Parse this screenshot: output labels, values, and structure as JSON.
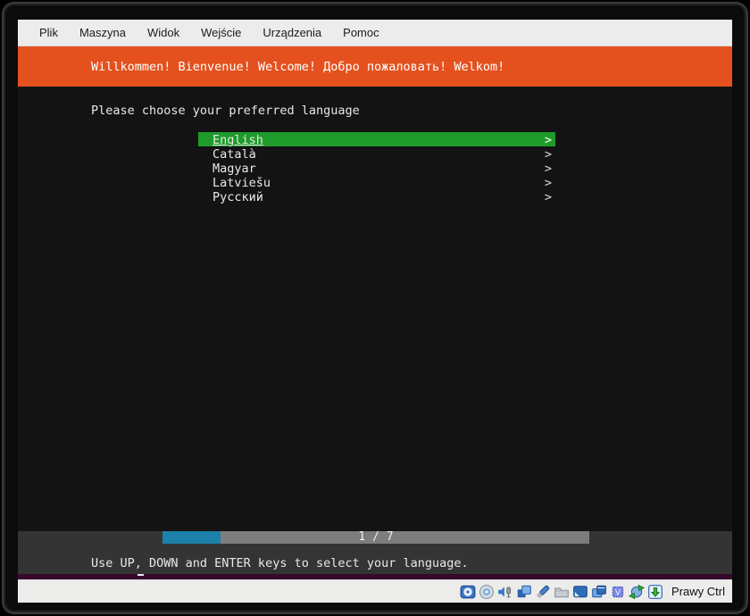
{
  "menubar": {
    "items": [
      "Plik",
      "Maszyna",
      "Widok",
      "Wejście",
      "Urządzenia",
      "Pomoc"
    ]
  },
  "banner": {
    "text": "Willkommen! Bienvenue! Welcome! Добро пожаловать! Welkom!"
  },
  "main": {
    "prompt": "Please choose your preferred language",
    "languages": [
      {
        "label": "English",
        "selected": true
      },
      {
        "label": "Català",
        "selected": false
      },
      {
        "label": "Magyar",
        "selected": false
      },
      {
        "label": "Latviešu",
        "selected": false
      },
      {
        "label": "Русский",
        "selected": false
      }
    ]
  },
  "glyphs": {
    "chevron": ">"
  },
  "footer": {
    "progress": {
      "current": 1,
      "total": 7,
      "label": "1 / 7",
      "percent": 13.5
    },
    "hint": "Use UP, DOWN and ENTER keys to select your language."
  },
  "statusbar": {
    "icons": [
      "hard-disks-icon",
      "optical-disc-icon",
      "audio-icon",
      "network-icon",
      "usb-icon",
      "shared-folders-icon",
      "display-icon",
      "video-capture-icon",
      "features-icon",
      "mouse-integration-icon",
      "keyboard-capture-icon"
    ],
    "host_key_label": "Prawy Ctrl"
  },
  "colors": {
    "banner_orange": "#e4511e",
    "terminal_bg": "#131313",
    "selection_green": "#1e9b2a",
    "progress_teal": "#1b80aa",
    "footer_gray": "#343434",
    "aubergine_strip": "#37092c",
    "chrome_gray": "#ececec"
  }
}
